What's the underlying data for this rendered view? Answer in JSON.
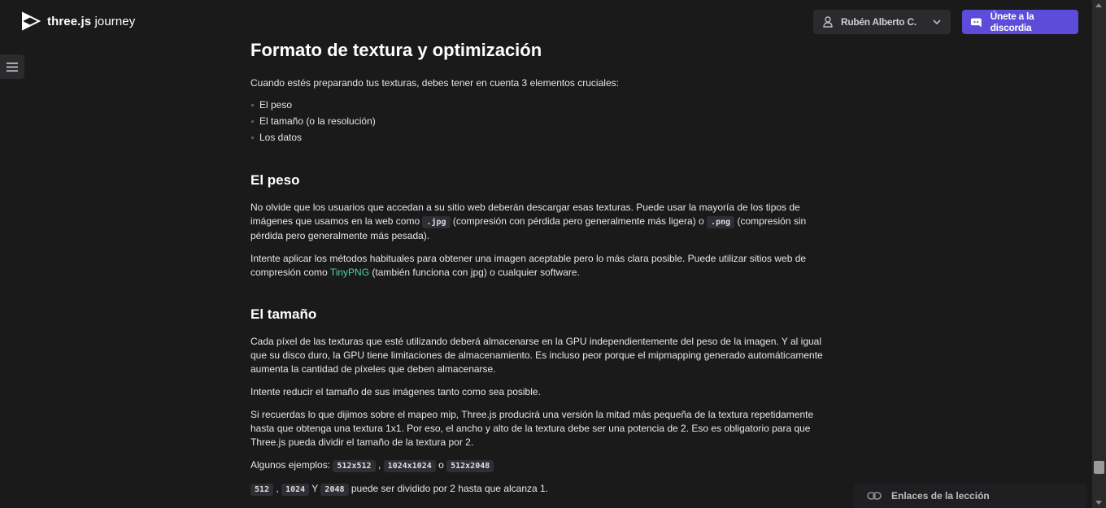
{
  "header": {
    "logo_bold": "three.js",
    "logo_light": " journey",
    "user_name": "Rubén Alberto C.",
    "discord_label": "Únete a la discordia"
  },
  "article": {
    "title": "Formato de textura y optimización",
    "intro": "Cuando estés preparando tus texturas, debes tener en cuenta 3 elementos cruciales:",
    "bullets": [
      "El peso",
      "El tamaño (o la resolución)",
      "Los datos"
    ],
    "section_weight": {
      "heading": "El peso",
      "p1_a": "No olvide que los usuarios que accedan a su sitio web deberán descargar esas texturas. Puede usar la mayoría de los tipos de imágenes que usamos en la web como ",
      "p1_code1": ".jpg",
      "p1_b": " (compresión con pérdida pero generalmente más ligera) o ",
      "p1_code2": ".png",
      "p1_c": " (compresión sin pérdida pero generalmente más pesada).",
      "p2_a": "Intente aplicar los métodos habituales para obtener una imagen aceptable pero lo más clara posible. Puede utilizar sitios web de compresión como ",
      "p2_link": "TinyPNG",
      "p2_b": " (también funciona con jpg) o cualquier software."
    },
    "section_size": {
      "heading": "El tamaño",
      "p1": "Cada píxel de las texturas que esté utilizando deberá almacenarse en la GPU independientemente del peso de la imagen. Y al igual que su disco duro, la GPU tiene limitaciones de almacenamiento. Es incluso peor porque el mipmapping generado automáticamente aumenta la cantidad de píxeles que deben almacenarse.",
      "p2": "Intente reducir el tamaño de sus imágenes tanto como sea posible.",
      "p3": "Si recuerdas lo que dijimos sobre el mapeo mip, Three.js producirá una versión la mitad más pequeña de la textura repetidamente hasta que obtenga una textura 1x1. Por eso, el ancho y alto de la textura debe ser una potencia de 2. Eso es obligatorio para que Three.js pueda dividir el tamaño de la textura por 2.",
      "p4_a": "Algunos ejemplos: ",
      "p4_code1": "512x512",
      "p4_sep1": " , ",
      "p4_code2": "1024x1024",
      "p4_sep2": " o ",
      "p4_code3": "512x2048",
      "p5_code1": "512",
      "p5_sep1": " , ",
      "p5_code2": "1024",
      "p5_sep2": " Y ",
      "p5_code3": "2048",
      "p5_b": " puede ser dividido por 2 hasta que alcanza 1."
    }
  },
  "footer": {
    "lesson_links_label": "Enlaces de la lección"
  },
  "colors": {
    "background": "#1a1a1b",
    "accent_discord": "#5d4bd9",
    "link": "#4fd1a6"
  }
}
